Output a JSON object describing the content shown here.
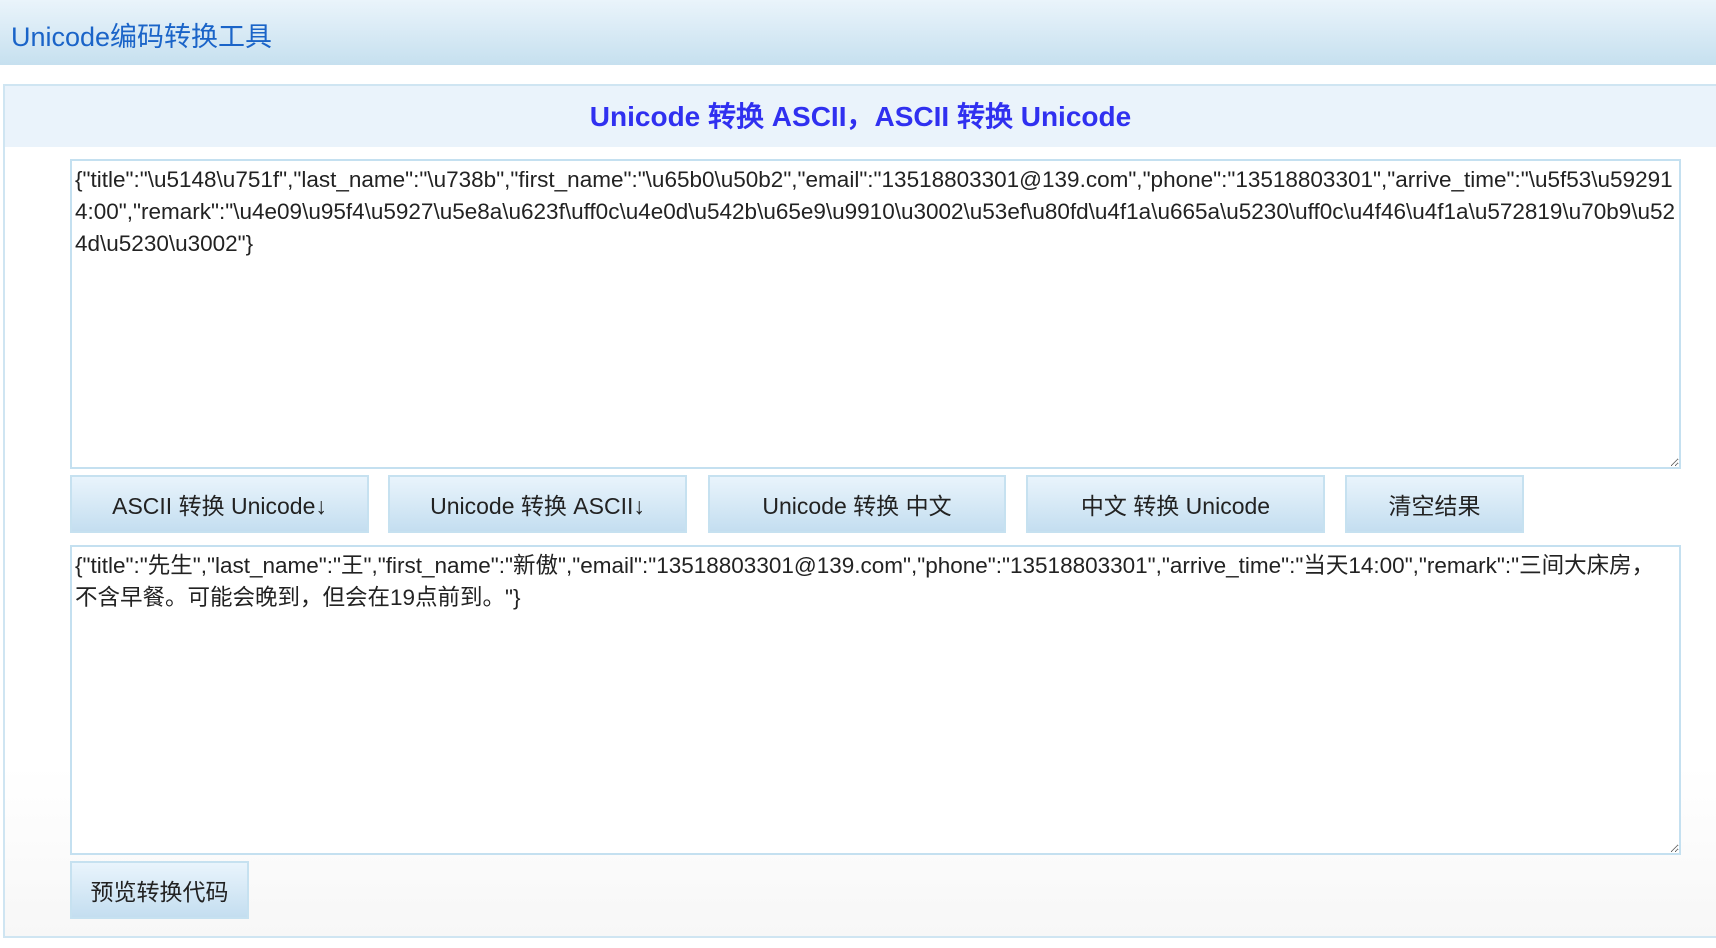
{
  "header": {
    "title": "Unicode编码转换工具"
  },
  "panel": {
    "title": "Unicode 转换 ASCII，ASCII 转换 Unicode"
  },
  "input": {
    "value": "{\"title\":\"\\u5148\\u751f\",\"last_name\":\"\\u738b\",\"first_name\":\"\\u65b0\\u50b2\",\"email\":\"13518803301@139.com\",\"phone\":\"13518803301\",\"arrive_time\":\"\\u5f53\\u592914:00\",\"remark\":\"\\u4e09\\u95f4\\u5927\\u5e8a\\u623f\\uff0c\\u4e0d\\u542b\\u65e9\\u9910\\u3002\\u53ef\\u80fd\\u4f1a\\u665a\\u5230\\uff0c\\u4f46\\u4f1a\\u572819\\u70b9\\u524d\\u5230\\u3002\"}"
  },
  "buttons": [
    {
      "label": "ASCII 转换 Unicode↓"
    },
    {
      "label": "Unicode 转换 ASCII↓"
    },
    {
      "label": "Unicode 转换 中文"
    },
    {
      "label": "中文 转换 Unicode"
    },
    {
      "label": "清空结果"
    }
  ],
  "output": {
    "value": "{\"title\":\"先生\",\"last_name\":\"王\",\"first_name\":\"新傲\",\"email\":\"13518803301@139.com\",\"phone\":\"13518803301\",\"arrive_time\":\"当天14:00\",\"remark\":\"三间大床房，不含早餐。可能会晚到，但会在19点前到。\"}"
  },
  "preview_button": {
    "label": "预览转换代码"
  }
}
